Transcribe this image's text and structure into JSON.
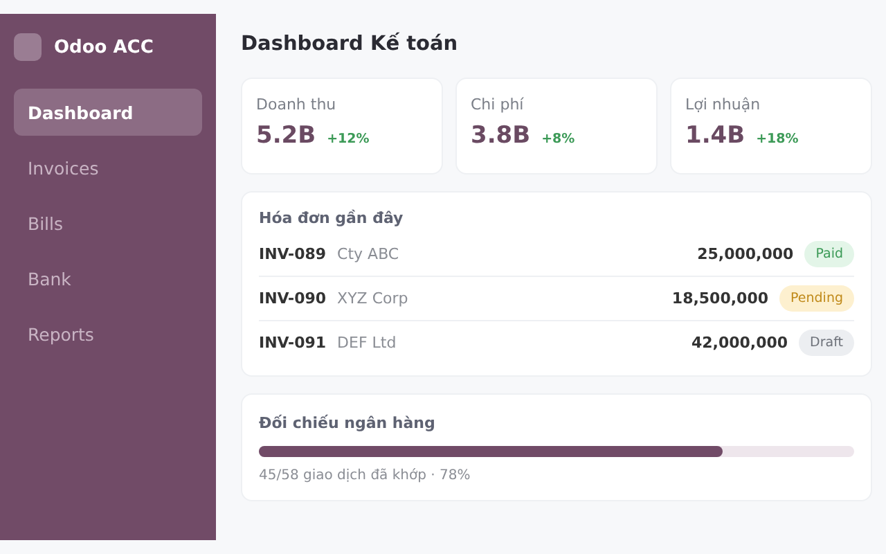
{
  "sidebar": {
    "brand": "Odoo ACC",
    "items": [
      {
        "label": "Dashboard",
        "selected": true
      },
      {
        "label": "Invoices",
        "selected": false
      },
      {
        "label": "Bills",
        "selected": false
      },
      {
        "label": "Bank",
        "selected": false
      },
      {
        "label": "Reports",
        "selected": false
      }
    ]
  },
  "page_title": "Dashboard Kế toán",
  "kpis": [
    {
      "label": "Doanh thu",
      "value": "5.2B",
      "change": "+12%"
    },
    {
      "label": "Chi phí",
      "value": "3.8B",
      "change": "+8%"
    },
    {
      "label": "Lợi nhuận",
      "value": "1.4B",
      "change": "+18%"
    }
  ],
  "recent_invoices": {
    "title": "Hóa đơn gần đây",
    "rows": [
      {
        "number": "INV-089",
        "customer": "Cty ABC",
        "amount": "25,000,000",
        "status": {
          "label": "Paid",
          "kind": "paid"
        }
      },
      {
        "number": "INV-090",
        "customer": "XYZ Corp",
        "amount": "18,500,000",
        "status": {
          "label": "Pending",
          "kind": "pending"
        }
      },
      {
        "number": "INV-091",
        "customer": "DEF Ltd",
        "amount": "42,000,000",
        "status": {
          "label": "Draft",
          "kind": "draft"
        }
      }
    ]
  },
  "bank_reconciliation": {
    "title": "Đối chiếu ngân hàng",
    "level": 0.78,
    "caption": "45/58 giao dịch đã khớp · 78%"
  }
}
